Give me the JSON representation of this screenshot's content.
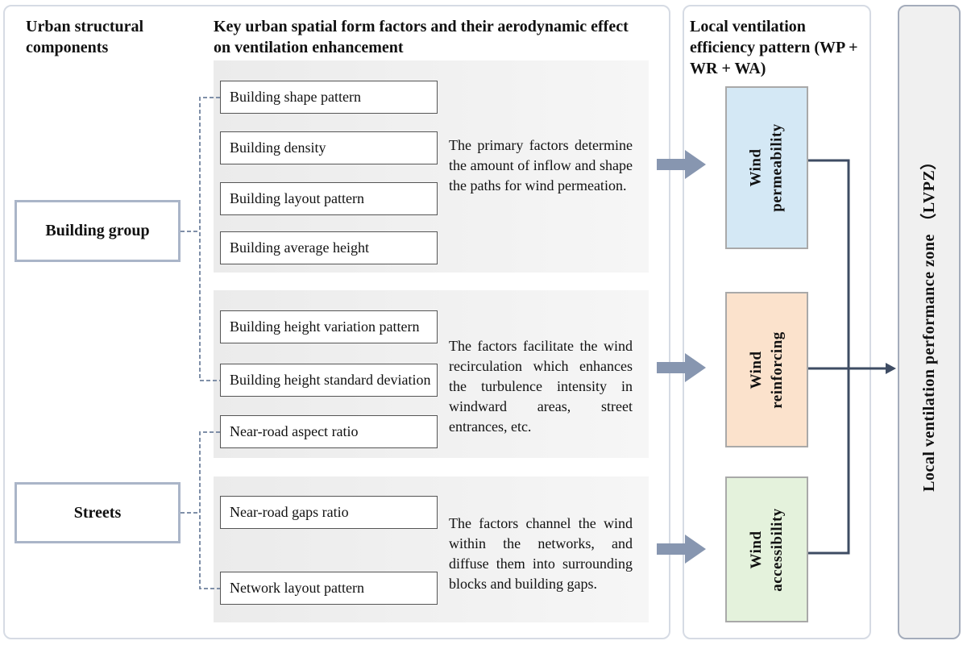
{
  "headers": {
    "components": "Urban structural components",
    "factors": "Key urban spatial form factors and their aerodynamic effect on ventilation enhancement",
    "pattern": "Local ventilation efficiency pattern (WP + WR + WA)"
  },
  "components": {
    "building": "Building group",
    "streets": "Streets"
  },
  "factors": [
    "Building shape pattern",
    "Building density",
    "Building layout pattern",
    "Building average height",
    "Building height variation pattern",
    "Building height standard deviation",
    "Near-road aspect ratio",
    "Near-road gaps ratio",
    "Network layout pattern"
  ],
  "descriptions": [
    "The primary factors determine the amount of inflow and shape the paths for wind permeation.",
    "The factors facilitate the wind recirculation which enhances the turbulence intensity in windward areas, street entrances, etc.",
    "The factors channel the wind within the networks, and diffuse them into surrounding blocks and building gaps."
  ],
  "wind": [
    {
      "line1": "Wind",
      "line2": "permeability",
      "color": "#d4e8f5"
    },
    {
      "line1": "Wind",
      "line2": "reinforcing",
      "color": "#fbe2cc"
    },
    {
      "line1": "Wind",
      "line2": "accessibility",
      "color": "#e4f2dc"
    }
  ],
  "zone": "Local ventilation performance zone （LVPZ）",
  "colors": {
    "arrow": "#8796b0",
    "connector": "#3e4c63",
    "dashed": "#7f8fa8"
  }
}
